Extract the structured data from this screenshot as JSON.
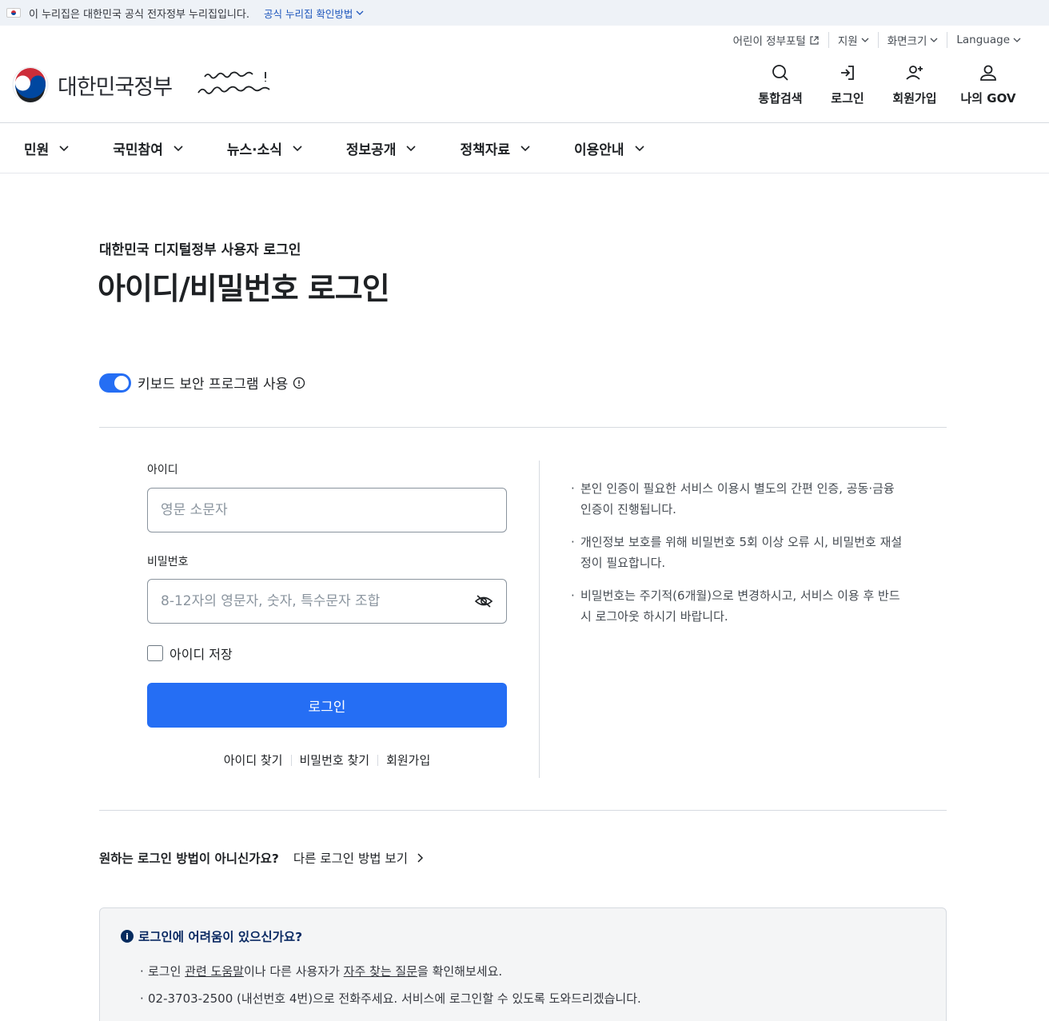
{
  "banner": {
    "text": "이 누리집은 대한민국 공식 전자정부 누리집입니다.",
    "link": "공식 누리집 확인방법"
  },
  "utility": {
    "kids": "어린이 정부포털",
    "support": "지원",
    "font_size": "화면크기",
    "language": "Language"
  },
  "logo": {
    "name": "대한민국정부",
    "slogan_line1": "다시 대한민국!",
    "slogan_line2": "새로운 국민의 나라"
  },
  "header_actions": {
    "search": "통합검색",
    "login": "로그인",
    "signup": "회원가입",
    "mygov": "나의 GOV"
  },
  "nav": [
    "민원",
    "국민참여",
    "뉴스·소식",
    "정보공개",
    "정책자료",
    "이용안내"
  ],
  "page": {
    "subtitle": "대한민국 디지털정부 사용자 로그인",
    "title": "아이디/비밀번호 로그인"
  },
  "keyboard_security": {
    "label": "키보드 보안 프로그램 사용",
    "enabled": true
  },
  "form": {
    "id_label": "아이디",
    "id_placeholder": "영문 소문자",
    "pw_label": "비밀번호",
    "pw_placeholder": "8-12자의 영문자, 숫자, 특수문자 조합",
    "save_id": "아이디 저장",
    "submit": "로그인",
    "find_id": "아이디 찾기",
    "find_pw": "비밀번호 찾기",
    "signup": "회원가입"
  },
  "notes": [
    "본인 인증이 필요한 서비스 이용시 별도의 간편 인증, 공동·금융 인증이 진행됩니다.",
    "개인정보 보호를 위해 비밀번호 5회 이상 오류 시, 비밀번호 재설정이 필요합니다.",
    "비밀번호는 주기적(6개월)으로 변경하시고, 서비스 이용 후 반드시 로그아웃 하시기 바랍니다."
  ],
  "other_login": {
    "question": "원하는 로그인 방법이 아니신가요?",
    "link": "다른 로그인 방법 보기"
  },
  "help": {
    "title": "로그인에 어려움이 있으신가요?",
    "line1_a": "로그인 ",
    "line1_link1": "관련 도움말",
    "line1_b": "이나 다른 사용자가 ",
    "line1_link2": "자주 찾는 질문",
    "line1_c": "을 확인해보세요.",
    "line2": "02-3703-2500 (내선번호 4번)으로 전화주세요. 서비스에 로그인할 수 있도록 도와드리겠습니다."
  },
  "colors": {
    "primary": "#256ef4",
    "banner_bg": "#eef2f7",
    "help_title": "#0b2a63"
  }
}
